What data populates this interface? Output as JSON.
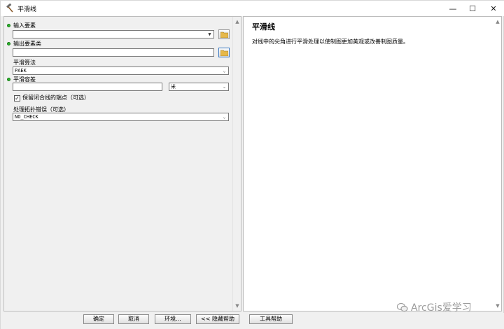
{
  "window": {
    "title": "平滑线",
    "minimize": "—",
    "maximize": "☐",
    "close": "✕"
  },
  "params": {
    "input_features": {
      "label": "输入要素",
      "value": ""
    },
    "output_feature_class": {
      "label": "输出要素类",
      "value": ""
    },
    "smoothing_algorithm": {
      "label": "平滑算法",
      "value": "PAEK"
    },
    "smoothing_tolerance": {
      "label": "平滑容差",
      "value": "",
      "unit": "米"
    },
    "preserve_endpoints": {
      "label": "保留闭合线的端点（可选）",
      "checked": true
    },
    "error_option": {
      "label": "处理拓扑错误（可选）",
      "value": "NO_CHECK"
    }
  },
  "help": {
    "title": "平滑线",
    "description": "对线中的尖角进行平滑处理以使制图更加美观或改善制图质量。"
  },
  "buttons": {
    "ok": "确定",
    "cancel": "取消",
    "environments": "环境...",
    "hide_help": "<< 隐藏帮助",
    "tool_help": "工具帮助"
  },
  "watermark": "ArcGis爱学习",
  "colors": {
    "required_dot": "#2db52d",
    "panel_bg": "#f0f0f0"
  }
}
